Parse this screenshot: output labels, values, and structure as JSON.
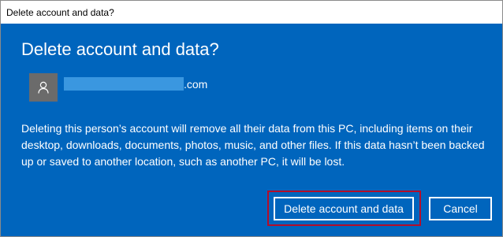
{
  "window": {
    "title": "Delete account and data?"
  },
  "dialog": {
    "heading": "Delete account and data?",
    "account": {
      "email_suffix": ".com",
      "avatar_icon": "user-icon"
    },
    "message": "Deleting this person’s account will remove all their data from this PC, including items on their desktop, downloads, documents, photos, music, and other files. If this data hasn’t been backed up or saved to another location, such as another PC, it will be lost.",
    "buttons": {
      "delete_label": "Delete account and data",
      "cancel_label": "Cancel"
    },
    "colors": {
      "background": "#0065bd",
      "highlight": "#b30d2a"
    }
  }
}
